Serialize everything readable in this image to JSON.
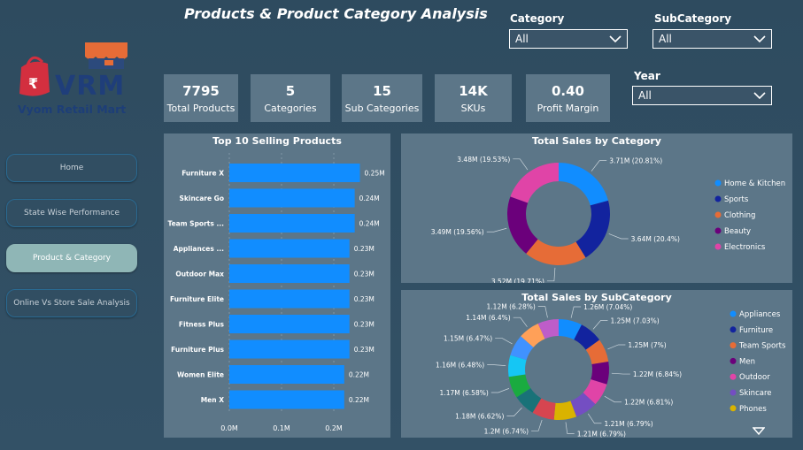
{
  "title": "Products & Product Category Analysis",
  "brand": {
    "short": "VRM",
    "name": "Vyom Retail Mart"
  },
  "nav": [
    {
      "label": "Home",
      "active": false
    },
    {
      "label": "State Wise Performance",
      "active": false
    },
    {
      "label": "Product & Category",
      "active": true
    },
    {
      "label": "Online Vs Store Sale Analysis",
      "active": false
    }
  ],
  "kpis": [
    {
      "value": "7795",
      "label": "Total Products"
    },
    {
      "value": "5",
      "label": "Categories"
    },
    {
      "value": "15",
      "label": "Sub Categories"
    },
    {
      "value": "14K",
      "label": "SKUs"
    },
    {
      "value": "0.40",
      "label": "Profit Margin"
    }
  ],
  "filters": {
    "category": {
      "label": "Category",
      "value": "All"
    },
    "subcategory": {
      "label": "SubCategory",
      "value": "All"
    },
    "year": {
      "label": "Year",
      "value": "All"
    }
  },
  "colors": {
    "bar": "#118dff",
    "panel": "#5c7688",
    "bg": "#2f4a5c"
  },
  "chart_data": [
    {
      "type": "bar",
      "orientation": "horizontal",
      "title": "Top 10 Selling Products",
      "categories": [
        "Furniture X",
        "Skincare Go",
        "Team Sports ...",
        "Appliances ...",
        "Outdoor Max",
        "Furniture Elite",
        "Fitness Plus",
        "Furniture Plus",
        "Women Elite",
        "Men X"
      ],
      "values": [
        0.25,
        0.24,
        0.24,
        0.23,
        0.23,
        0.23,
        0.23,
        0.23,
        0.22,
        0.22
      ],
      "labels": [
        "0.25M",
        "0.24M",
        "0.24M",
        "0.23M",
        "0.23M",
        "0.23M",
        "0.23M",
        "0.23M",
        "0.22M",
        "0.22M"
      ],
      "xticks": [
        "0.0M",
        "0.1M",
        "0.2M"
      ],
      "xlim": [
        0,
        0.25
      ]
    },
    {
      "type": "pie",
      "donut": true,
      "title": "Total Sales by Category",
      "slices": [
        {
          "name": "Home & Kitchen",
          "value": 3.71,
          "label": "3.71M (20.81%)",
          "color": "#118dff"
        },
        {
          "name": "Sports",
          "value": 3.64,
          "label": "3.64M (20.4%)",
          "color": "#12239e"
        },
        {
          "name": "Clothing",
          "value": 3.52,
          "label": "3.52M (19.71%)",
          "color": "#e66c37"
        },
        {
          "name": "Beauty",
          "value": 3.49,
          "label": "3.49M (19.56%)",
          "color": "#6b007b"
        },
        {
          "name": "Electronics",
          "value": 3.48,
          "label": "3.48M (19.53%)",
          "color": "#e044a7"
        }
      ],
      "legend": "right"
    },
    {
      "type": "pie",
      "donut": true,
      "title": "Total Sales by SubCategory",
      "slices": [
        {
          "name": "Appliances",
          "value": 1.26,
          "label": "1.26M (7.04%)",
          "color": "#118dff"
        },
        {
          "name": "Furniture",
          "value": 1.25,
          "label": "1.25M (7.03%)",
          "color": "#12239e"
        },
        {
          "name": "Team Sports",
          "value": 1.25,
          "label": "1.25M (7%)",
          "color": "#e66c37"
        },
        {
          "name": "Men",
          "value": 1.22,
          "label": "1.22M (6.84%)",
          "color": "#6b007b"
        },
        {
          "name": "Outdoor",
          "value": 1.22,
          "label": "1.22M (6.81%)",
          "color": "#e044a7"
        },
        {
          "name": "Skincare",
          "value": 1.21,
          "label": "1.21M (6.79%)",
          "color": "#744ec2"
        },
        {
          "name": "Phones",
          "value": 1.21,
          "label": "1.21M (6.79%)",
          "color": "#d9b300"
        },
        {
          "name": "",
          "value": 1.2,
          "label": "1.2M (6.74%)",
          "color": "#d64550"
        },
        {
          "name": "",
          "value": 1.18,
          "label": "1.18M (6.62%)",
          "color": "#197278"
        },
        {
          "name": "",
          "value": 1.17,
          "label": "1.17M (6.58%)",
          "color": "#1aab40"
        },
        {
          "name": "",
          "value": 1.16,
          "label": "1.16M (6.48%)",
          "color": "#15c6f4"
        },
        {
          "name": "",
          "value": 1.15,
          "label": "1.15M (6.47%)",
          "color": "#4092ff"
        },
        {
          "name": "",
          "value": 1.14,
          "label": "1.14M (6.4%)",
          "color": "#ffa058"
        },
        {
          "name": "",
          "value": 1.12,
          "label": "1.12M (6.28%)",
          "color": "#be5dc9"
        }
      ],
      "legend": "right"
    }
  ]
}
